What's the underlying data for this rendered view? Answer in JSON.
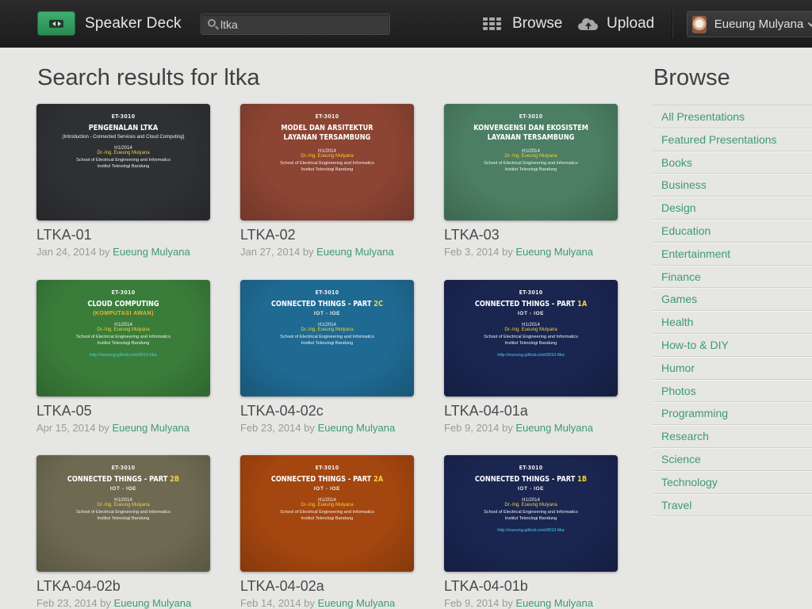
{
  "header": {
    "site_name": "Speaker Deck",
    "search_value": "ltka",
    "nav_browse": "Browse",
    "nav_upload": "Upload",
    "user_name": "Eueung Mulyana"
  },
  "main": {
    "title": "Search results for ltka",
    "decks": [
      {
        "title": "LTKA-01",
        "date": "Jan 24, 2014",
        "by": "by",
        "author": "Eueung Mulyana",
        "bg": "#2e3033",
        "slide": {
          "course": "ET-3010",
          "title_pre": "PENGENALAN LTKA",
          "title_hl": "",
          "sub": "(Introduction - Connected Services and Cloud Computing)",
          "term": "H1/2014",
          "author": "Dr.-Ing. Eueung Mulyana",
          "school1": "School of Electrical Engineering and Informatics",
          "school2": "Institut Teknologi Bandung",
          "url": ""
        }
      },
      {
        "title": "LTKA-02",
        "date": "Jan 27, 2014",
        "by": "by",
        "author": "Eueung Mulyana",
        "bg": "#8c4433",
        "slide": {
          "course": "ET-3010",
          "title_pre": "MODEL DAN ARSITEKTUR LAYANAN TERSAMBUNG",
          "title_hl": "",
          "sub": "",
          "term": "H1/2014",
          "author": "Dr.-Ing. Eueung Mulyana",
          "school1": "School of Electrical Engineering and Informatics",
          "school2": "Institut Teknologi Bandung",
          "url": ""
        }
      },
      {
        "title": "LTKA-03",
        "date": "Feb 3, 2014",
        "by": "by",
        "author": "Eueung Mulyana",
        "bg": "#4b7e62",
        "slide": {
          "course": "ET-3010",
          "title_pre": "KONVERGENSI DAN EKOSISTEM LAYANAN TERSAMBUNG",
          "title_hl": "",
          "sub": "",
          "term": "H1/2014",
          "author": "Dr.-Ing. Eueung Mulyana",
          "school1": "School of Electrical Engineering and Informatics",
          "school2": "Institut Teknologi Bandung",
          "url": ""
        }
      },
      {
        "title": "LTKA-05",
        "date": "Apr 15, 2014",
        "by": "by",
        "author": "Eueung Mulyana",
        "bg": "#3a7d3a",
        "slide": {
          "course": "ET-3010",
          "title_pre": "CLOUD COMPUTING",
          "title_hl": "",
          "sub": "(KOMPUTASI AWAN)",
          "term": "H1/2014",
          "author": "Dr.-Ing. Eueung Mulyana",
          "school1": "School of Electrical Engineering and Informatics",
          "school2": "Institut Teknologi Bandung",
          "url": "http://eueung.github.io/et3010-ltka"
        }
      },
      {
        "title": "LTKA-04-02c",
        "date": "Feb 23, 2014",
        "by": "by",
        "author": "Eueung Mulyana",
        "bg": "#1f6a93",
        "slide": {
          "course": "ET-3010",
          "title_pre": "CONNECTED THINGS - PART ",
          "title_hl": "2C",
          "sub": "IOT - IOE",
          "term": "H1/2014",
          "author": "Dr.-Ing. Eueung Mulyana",
          "school1": "School of Electrical Engineering and Informatics",
          "school2": "Institut Teknologi Bandung",
          "url": ""
        }
      },
      {
        "title": "LTKA-04-01a",
        "date": "Feb 9, 2014",
        "by": "by",
        "author": "Eueung Mulyana",
        "bg": "#1a2550",
        "slide": {
          "course": "ET-3010",
          "title_pre": "CONNECTED THINGS - PART ",
          "title_hl": "1A",
          "sub": "IOT - IOE",
          "term": "H1/2014",
          "author": "Dr.-Ing. Eueung Mulyana",
          "school1": "School of Electrical Engineering and Informatics",
          "school2": "Institut Teknologi Bandung",
          "url": "http://eueung.github.io/et3010-ltka"
        }
      },
      {
        "title": "LTKA-04-02b",
        "date": "Feb 23, 2014",
        "by": "by",
        "author": "Eueung Mulyana",
        "bg": "#6e6a52",
        "slide": {
          "course": "ET-3010",
          "title_pre": "CONNECTED THINGS - PART ",
          "title_hl": "2B",
          "sub": "IOT - IOE",
          "term": "H1/2014",
          "author": "Dr.-Ing. Eueung Mulyana",
          "school1": "School of Electrical Engineering and Informatics",
          "school2": "Institut Teknologi Bandung",
          "url": ""
        }
      },
      {
        "title": "LTKA-04-02a",
        "date": "Feb 14, 2014",
        "by": "by",
        "author": "Eueung Mulyana",
        "bg": "#a4460f",
        "slide": {
          "course": "ET-3010",
          "title_pre": "CONNECTED THINGS - PART ",
          "title_hl": "2A",
          "sub": "IOT - IOE",
          "term": "H1/2014",
          "author": "Dr.-Ing. Eueung Mulyana",
          "school1": "School of Electrical Engineering and Informatics",
          "school2": "Institut Teknologi Bandung",
          "url": ""
        }
      },
      {
        "title": "LTKA-04-01b",
        "date": "Feb 9, 2014",
        "by": "by",
        "author": "Eueung Mulyana",
        "bg": "#1a2550",
        "slide": {
          "course": "ET-3010",
          "title_pre": "CONNECTED THINGS - PART ",
          "title_hl": "1B",
          "sub": "IOT - IOE",
          "term": "H1/2014",
          "author": "Dr.-Ing. Eueung Mulyana",
          "school1": "School of Electrical Engineering and Informatics",
          "school2": "Institut Teknologi Bandung",
          "url": "http://eueung.github.io/et3010-ltka"
        }
      }
    ]
  },
  "sidebar": {
    "title": "Browse",
    "categories": [
      "All Presentations",
      "Featured Presentations",
      "Books",
      "Business",
      "Design",
      "Education",
      "Entertainment",
      "Finance",
      "Games",
      "Health",
      "How-to & DIY",
      "Humor",
      "Photos",
      "Programming",
      "Research",
      "Science",
      "Technology",
      "Travel"
    ]
  },
  "icons": {
    "logo": "speakerdeck-logo-icon",
    "search": "search-icon",
    "browse": "grid-icon",
    "upload": "cloud-upload-icon",
    "user_menu": "chevron-down-icon"
  },
  "colors": {
    "accent": "#3d9a73",
    "brand_green": "#2f9a5c",
    "header_bg": "#222222",
    "page_bg": "#e6e6e4"
  }
}
